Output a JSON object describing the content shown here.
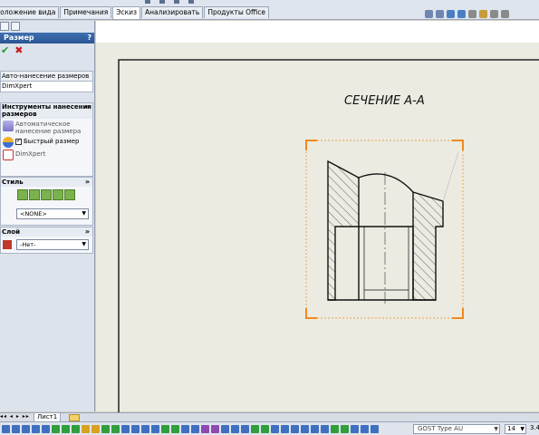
{
  "tabs": [
    {
      "label": "Расположение вида",
      "active": false
    },
    {
      "label": "Примечания",
      "active": false
    },
    {
      "label": "Эскиз",
      "active": true
    },
    {
      "label": "Анализировать",
      "active": false
    },
    {
      "label": "Продукты Office",
      "active": false
    }
  ],
  "property_manager": {
    "title": "Размер",
    "help": "?",
    "ok_symbol": "✔",
    "cancel_symbol": "✖",
    "tab_auto": "Авто-нанесение размеров",
    "tab_dimxpert": "DimXpert",
    "tools_group": {
      "title": "Инструменты нанесения размеров",
      "auto_dim": "Автоматическое нанесение размера",
      "quick_dim": "Быстрый размер",
      "dimxpert": "DimXpert"
    },
    "style_group": {
      "title": "Стиль",
      "style_value": "<NONE>"
    },
    "layer_group": {
      "title": "Слой",
      "layer_value": "-Нет-"
    }
  },
  "drawing": {
    "section_label": "СЕЧЕНИЕ А-А"
  },
  "sheet_tabs": {
    "nav": "◂◂ ◂ ▸ ▸▸",
    "active_sheet": "Лист1"
  },
  "bottom_bar": {
    "font": "GOST Type AU",
    "size": "14",
    "scale": "3.4"
  },
  "colors": {
    "accent": "#2b5694",
    "selection": "#f08a1c",
    "sheet": "#ebebe2",
    "hatch": "#333333"
  }
}
